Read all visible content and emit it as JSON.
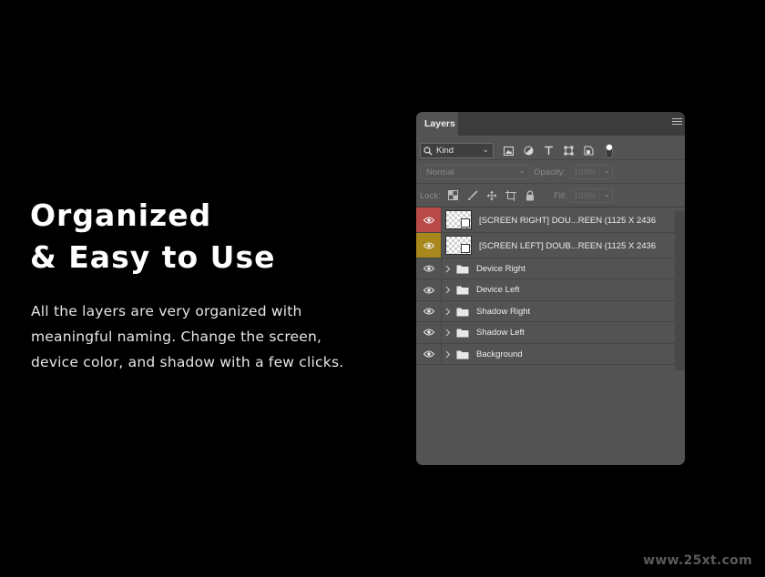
{
  "headline": {
    "line1": "Organized",
    "line2": "& Easy to Use"
  },
  "body_copy": {
    "line1": "All the layers are very organized with",
    "line2": "meaningful naming. Change the screen,",
    "line3": "device color, and shadow with a few clicks."
  },
  "watermark": "www.25xt.com",
  "panel": {
    "tab_label": "Layers",
    "filter": {
      "kind_label": "Kind",
      "icons": [
        "image-filter-icon",
        "adjustment-filter-icon",
        "type-filter-icon",
        "shape-filter-icon",
        "smart-object-filter-icon",
        "filter-toggle-icon"
      ]
    },
    "blend": {
      "mode": "Normal",
      "opacity_label": "Opacity:",
      "opacity_value": "100%"
    },
    "lock": {
      "label": "Lock:",
      "icons": [
        "lock-transparent-pixels-icon",
        "lock-image-pixels-icon",
        "lock-position-icon",
        "lock-artboard-icon",
        "lock-all-icon"
      ],
      "fill_label": "Fill:",
      "fill_value": "100%"
    },
    "layers": [
      {
        "type": "smart",
        "name": "[SCREEN RIGHT] DOU...REEN (1125 X 2436",
        "eye_bg": "#b94a48"
      },
      {
        "type": "smart",
        "name": "[SCREEN LEFT] DOUB...REEN (1125 X 2436",
        "eye_bg": "#a8871c"
      },
      {
        "type": "group",
        "name": "Device Right"
      },
      {
        "type": "group",
        "name": "Device Left"
      },
      {
        "type": "group",
        "name": "Shadow Right"
      },
      {
        "type": "group",
        "name": "Shadow Left"
      },
      {
        "type": "group",
        "name": "Background"
      }
    ]
  },
  "colors": {
    "page_bg": "#000000",
    "panel_bg": "#535353",
    "panel_header": "#3c3c3c",
    "red_label": "#b94a48",
    "yellow_label": "#a8871c"
  }
}
